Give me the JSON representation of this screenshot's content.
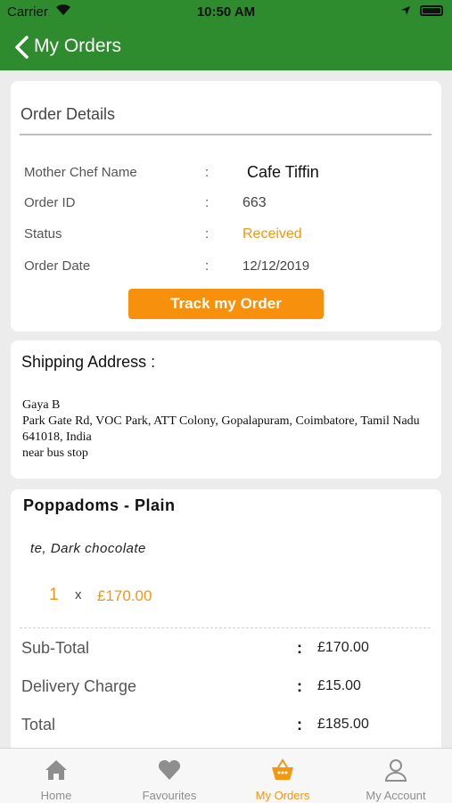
{
  "status_bar": {
    "carrier": "Carrier",
    "time": "10:50 AM"
  },
  "nav": {
    "title": "My Orders"
  },
  "order": {
    "section_title": "Order Details",
    "rows": [
      {
        "label": "Mother Chef Name",
        "colon": ":",
        "value": "Cafe Tiffin"
      },
      {
        "label": "Order ID",
        "colon": ":",
        "value": "663"
      },
      {
        "label": "Status",
        "colon": ":",
        "value": "Received"
      },
      {
        "label": "Order Date",
        "colon": ":",
        "value": "12/12/2019"
      }
    ],
    "track_button": "Track my Order"
  },
  "shipping": {
    "title": "Shipping Address :",
    "lines": [
      "Gaya B",
      "Park Gate Rd, VOC Park, ATT Colony, Gopalapuram, Coimbatore, Tamil Nadu 641018, India",
      "near bus stop"
    ]
  },
  "item": {
    "name": "Poppadoms - Plain",
    "description": "te, Dark chocolate",
    "quantity": "1",
    "times": "x",
    "price": "£170.00"
  },
  "summary": [
    {
      "label": "Sub-Total",
      "colon": ":",
      "value": "£170.00"
    },
    {
      "label": "Delivery Charge",
      "colon": ":",
      "value": "£15.00"
    },
    {
      "label": "Total",
      "colon": ":",
      "value": "£185.00"
    }
  ],
  "tabs": [
    {
      "label": "Home",
      "icon": "home-icon"
    },
    {
      "label": "Favourites",
      "icon": "heart-icon"
    },
    {
      "label": "My Orders",
      "icon": "basket-icon"
    },
    {
      "label": "My Account",
      "icon": "person-icon"
    }
  ],
  "colors": {
    "header": "#2e8b2e",
    "accent": "#f7900d",
    "background": "#ececec"
  }
}
